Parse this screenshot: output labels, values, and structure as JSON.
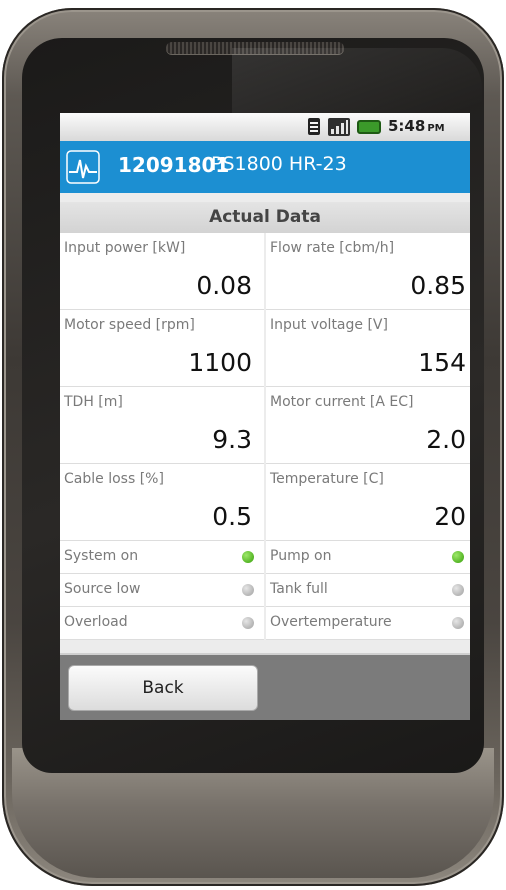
{
  "status_bar": {
    "time": "5:48",
    "ampm": "PM"
  },
  "header": {
    "device_id": "12091801",
    "model": "PS1800 HR-23"
  },
  "section_title": "Actual Data",
  "measurements": [
    {
      "label": "Input power [kW]",
      "value": "0.08"
    },
    {
      "label": "Flow rate [cbm/h]",
      "value": "0.85"
    },
    {
      "label": "Motor speed [rpm]",
      "value": "1100"
    },
    {
      "label": "Input voltage [V]",
      "value": "154"
    },
    {
      "label": "TDH [m]",
      "value": "9.3"
    },
    {
      "label": "Motor current [A EC]",
      "value": "2.0"
    },
    {
      "label": "Cable loss [%]",
      "value": "0.5"
    },
    {
      "label": "Temperature [C]",
      "value": "20"
    }
  ],
  "indicators": [
    {
      "label": "System on",
      "state": "on",
      "color": "#5bc22a"
    },
    {
      "label": "Pump on",
      "state": "on",
      "color": "#5bc22a"
    },
    {
      "label": "Source low",
      "state": "off",
      "color": "#c0c0c0"
    },
    {
      "label": "Tank full",
      "state": "off",
      "color": "#c0c0c0"
    },
    {
      "label": "Overload",
      "state": "off",
      "color": "#c0c0c0"
    },
    {
      "label": "Overtemperature",
      "state": "off",
      "color": "#c0c0c0"
    }
  ],
  "back_button": {
    "label": "Back"
  },
  "colors": {
    "titlebar": "#1c8fd2",
    "indicator_on": "#5bc22a",
    "indicator_off": "#c0c0c0"
  },
  "icons": [
    "pulse-icon",
    "sim-card-icon",
    "signal-bars-icon",
    "battery-icon"
  ]
}
